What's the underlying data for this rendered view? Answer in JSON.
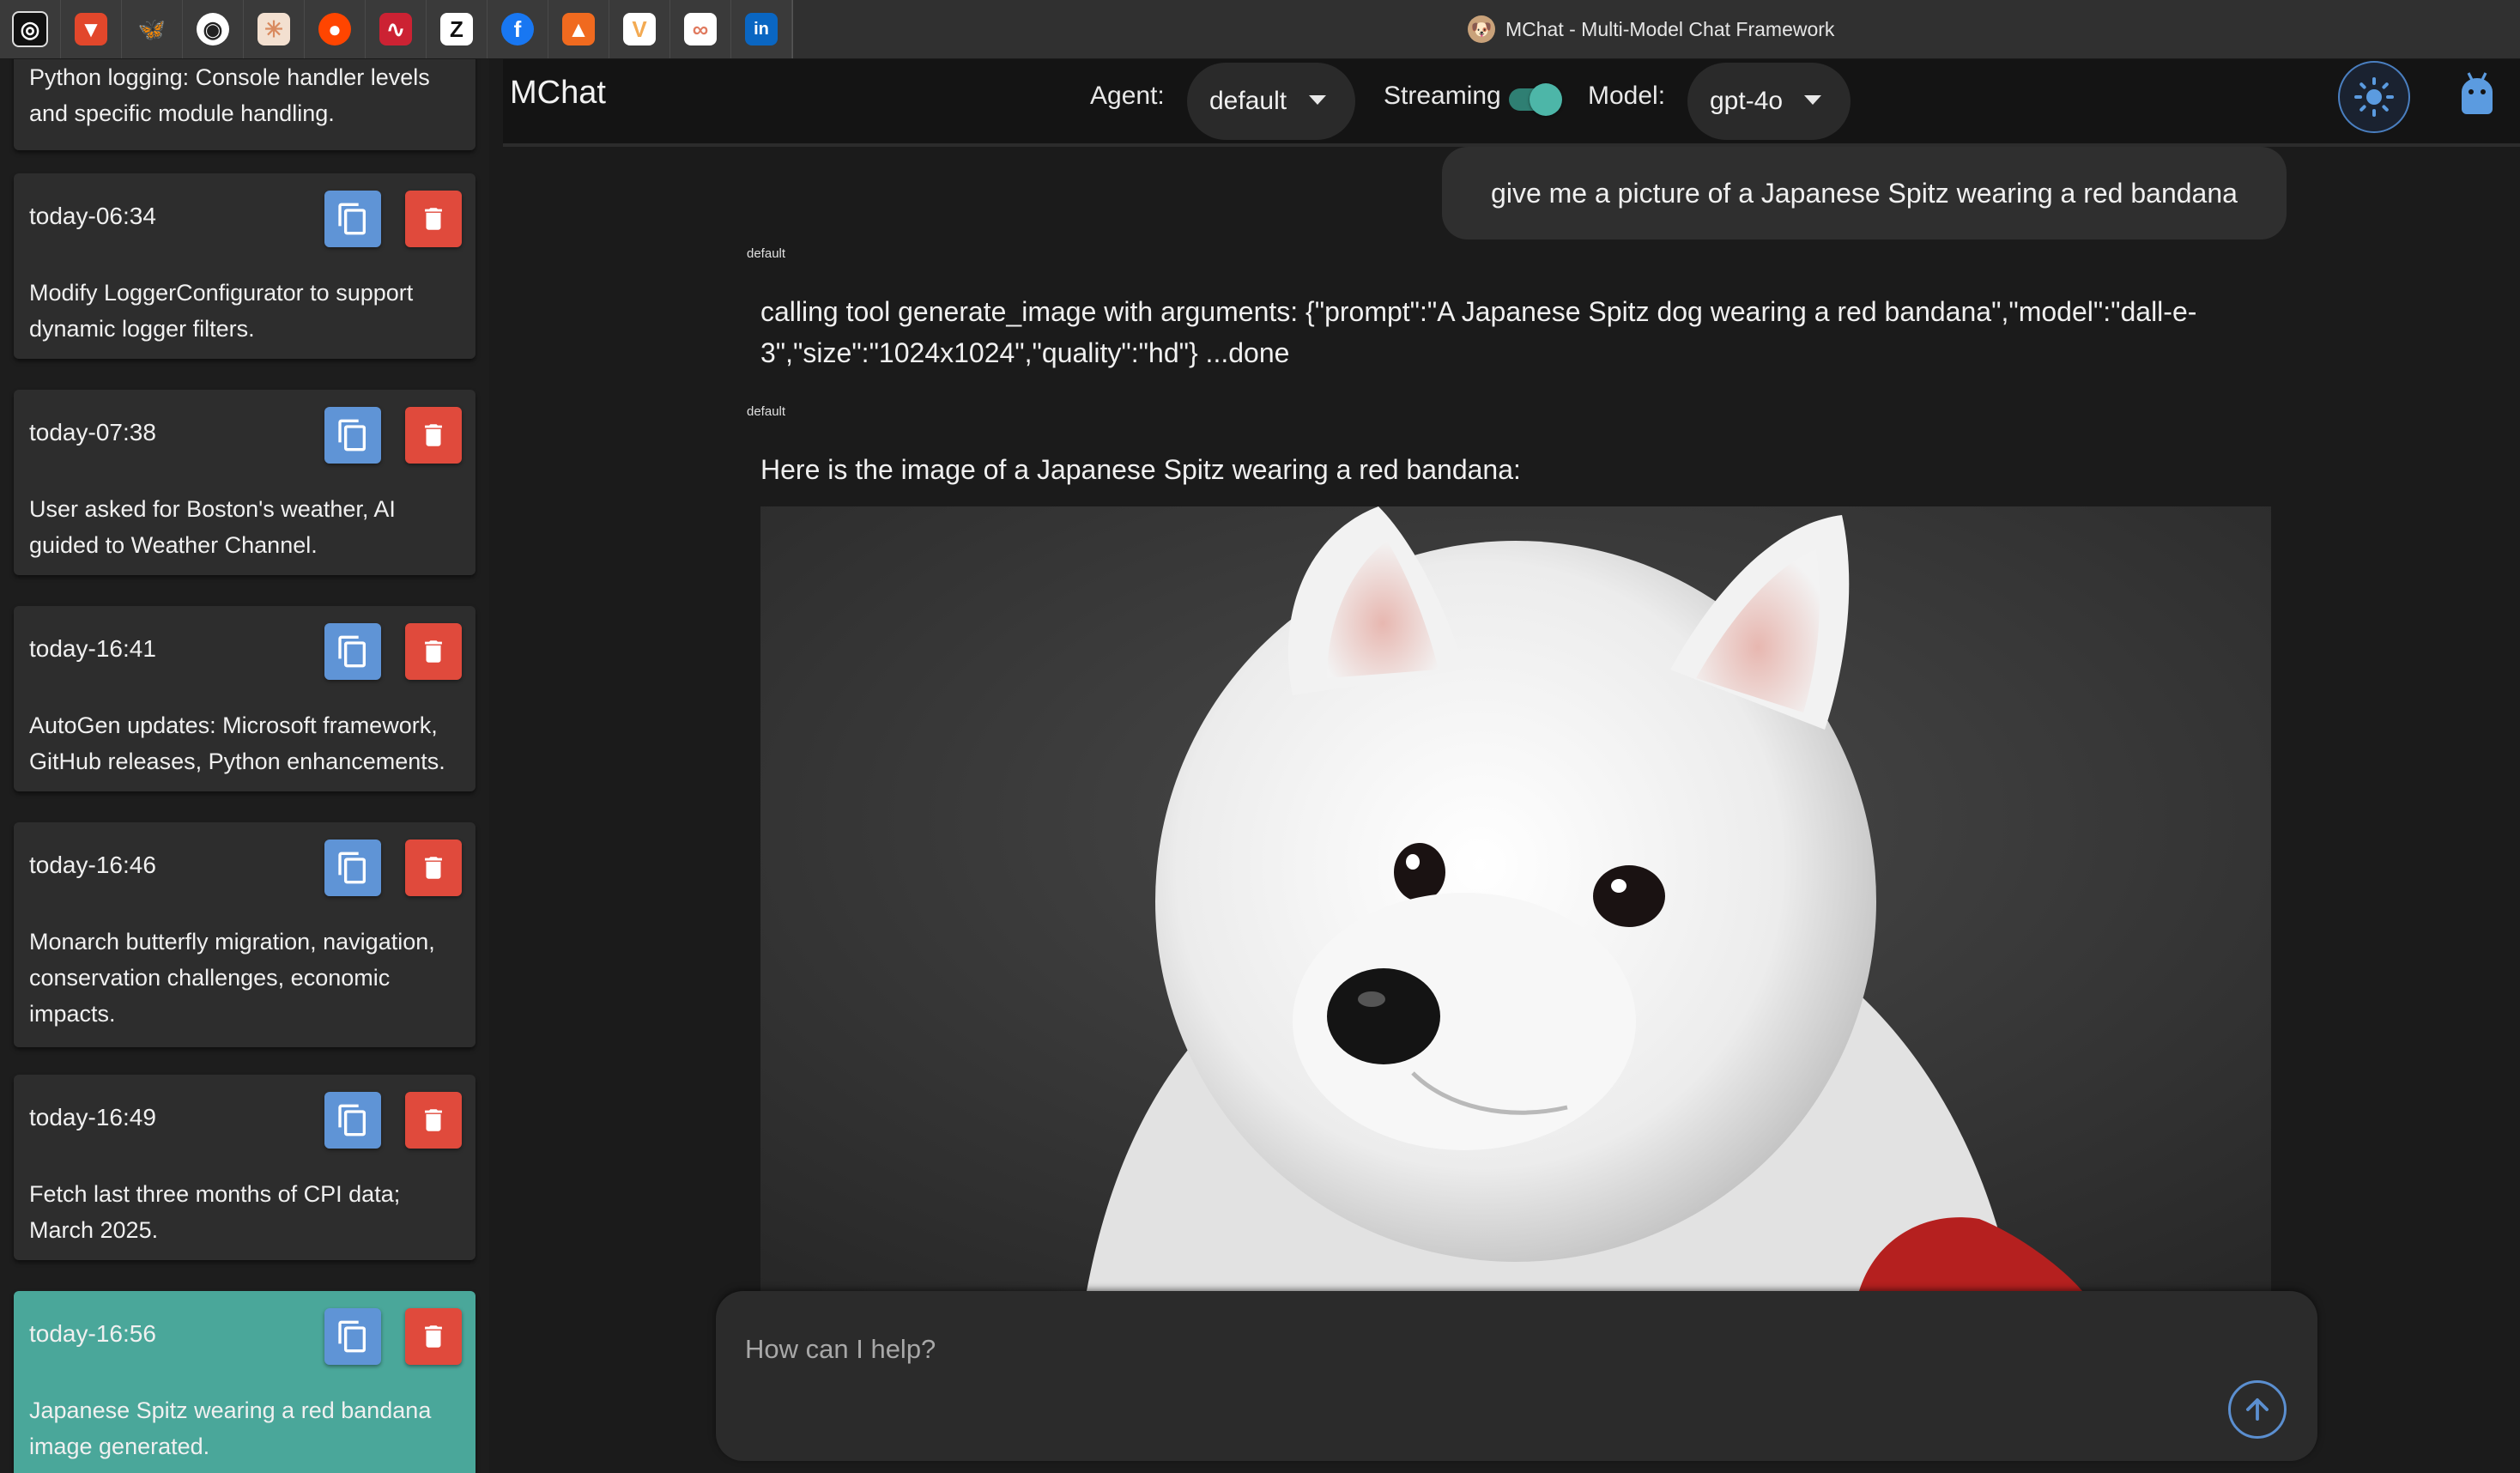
{
  "window": {
    "title": "MChat - Multi-Model Chat Framework"
  },
  "favorites": [
    {
      "icon": "openai-icon",
      "glyph": "◎",
      "color": "#111111"
    },
    {
      "icon": "brave-icon",
      "glyph": "▼",
      "color": "#e2472b"
    },
    {
      "icon": "bluesky-icon",
      "glyph": "🦋",
      "color": "#1d7cf2"
    },
    {
      "icon": "github-icon",
      "glyph": "◉",
      "color": "#222222"
    },
    {
      "icon": "claude-icon",
      "glyph": "✳",
      "color": "#d98a5f"
    },
    {
      "icon": "reddit-icon",
      "glyph": "●",
      "color": "#ff4500"
    },
    {
      "icon": "health-pulse-icon",
      "glyph": "∿",
      "color": "#cc2233"
    },
    {
      "icon": "zed-icon",
      "glyph": "Z",
      "color": "#111111"
    },
    {
      "icon": "facebook-icon",
      "glyph": "f",
      "color": "#1877f2"
    },
    {
      "icon": "aws-icon",
      "glyph": "▲",
      "color": "#f06a1f"
    },
    {
      "icon": "vivaldi-icon",
      "glyph": "V",
      "color": "#f3aa52"
    },
    {
      "icon": "infinity-icon",
      "glyph": "∞",
      "color": "#e07a5f"
    },
    {
      "icon": "linkedin-icon",
      "glyph": "in",
      "color": "#0a66c2"
    }
  ],
  "sidebar": {
    "items": [
      {
        "time": "",
        "summary": "Python logging: Console handler levels and specific module handling.",
        "active": false
      },
      {
        "time": "today-06:34",
        "summary": "Modify LoggerConfigurator to support dynamic logger filters.",
        "active": false
      },
      {
        "time": "today-07:38",
        "summary": "User asked for Boston's weather, AI guided to Weather Channel.",
        "active": false
      },
      {
        "time": "today-16:41",
        "summary": "AutoGen updates: Microsoft framework, GitHub releases, Python enhancements.",
        "active": false
      },
      {
        "time": "today-16:46",
        "summary": "Monarch butterfly migration, navigation, conservation challenges, economic impacts.",
        "active": false
      },
      {
        "time": "today-16:49",
        "summary": "Fetch last three months of CPI data; March 2025.",
        "active": false
      },
      {
        "time": "today-16:56",
        "summary": "Japanese Spitz wearing a red bandana image generated.",
        "active": true
      }
    ]
  },
  "header": {
    "app_title": "MChat",
    "agent_label": "Agent:",
    "agent_value": "default",
    "streaming_label": "Streaming",
    "streaming_on": true,
    "model_label": "Model:",
    "model_value": "gpt-4o"
  },
  "chat": {
    "user_message": "give me a picture of a Japanese Spitz wearing a red bandana",
    "messages": [
      {
        "agent": "default",
        "text": "calling tool generate_image with arguments: {\"prompt\":\"A Japanese Spitz dog wearing a red bandana\",\"model\":\"dall-e-3\",\"size\":\"1024x1024\",\"quality\":\"hd\"} ...done"
      },
      {
        "agent": "default",
        "text": "Here is the image of a Japanese Spitz wearing a red bandana:"
      }
    ]
  },
  "composer": {
    "placeholder": "How can I help?"
  },
  "colors": {
    "accent_teal": "#4aa79a",
    "copy_blue": "#5f94d6",
    "delete_red": "#e04a3c"
  }
}
